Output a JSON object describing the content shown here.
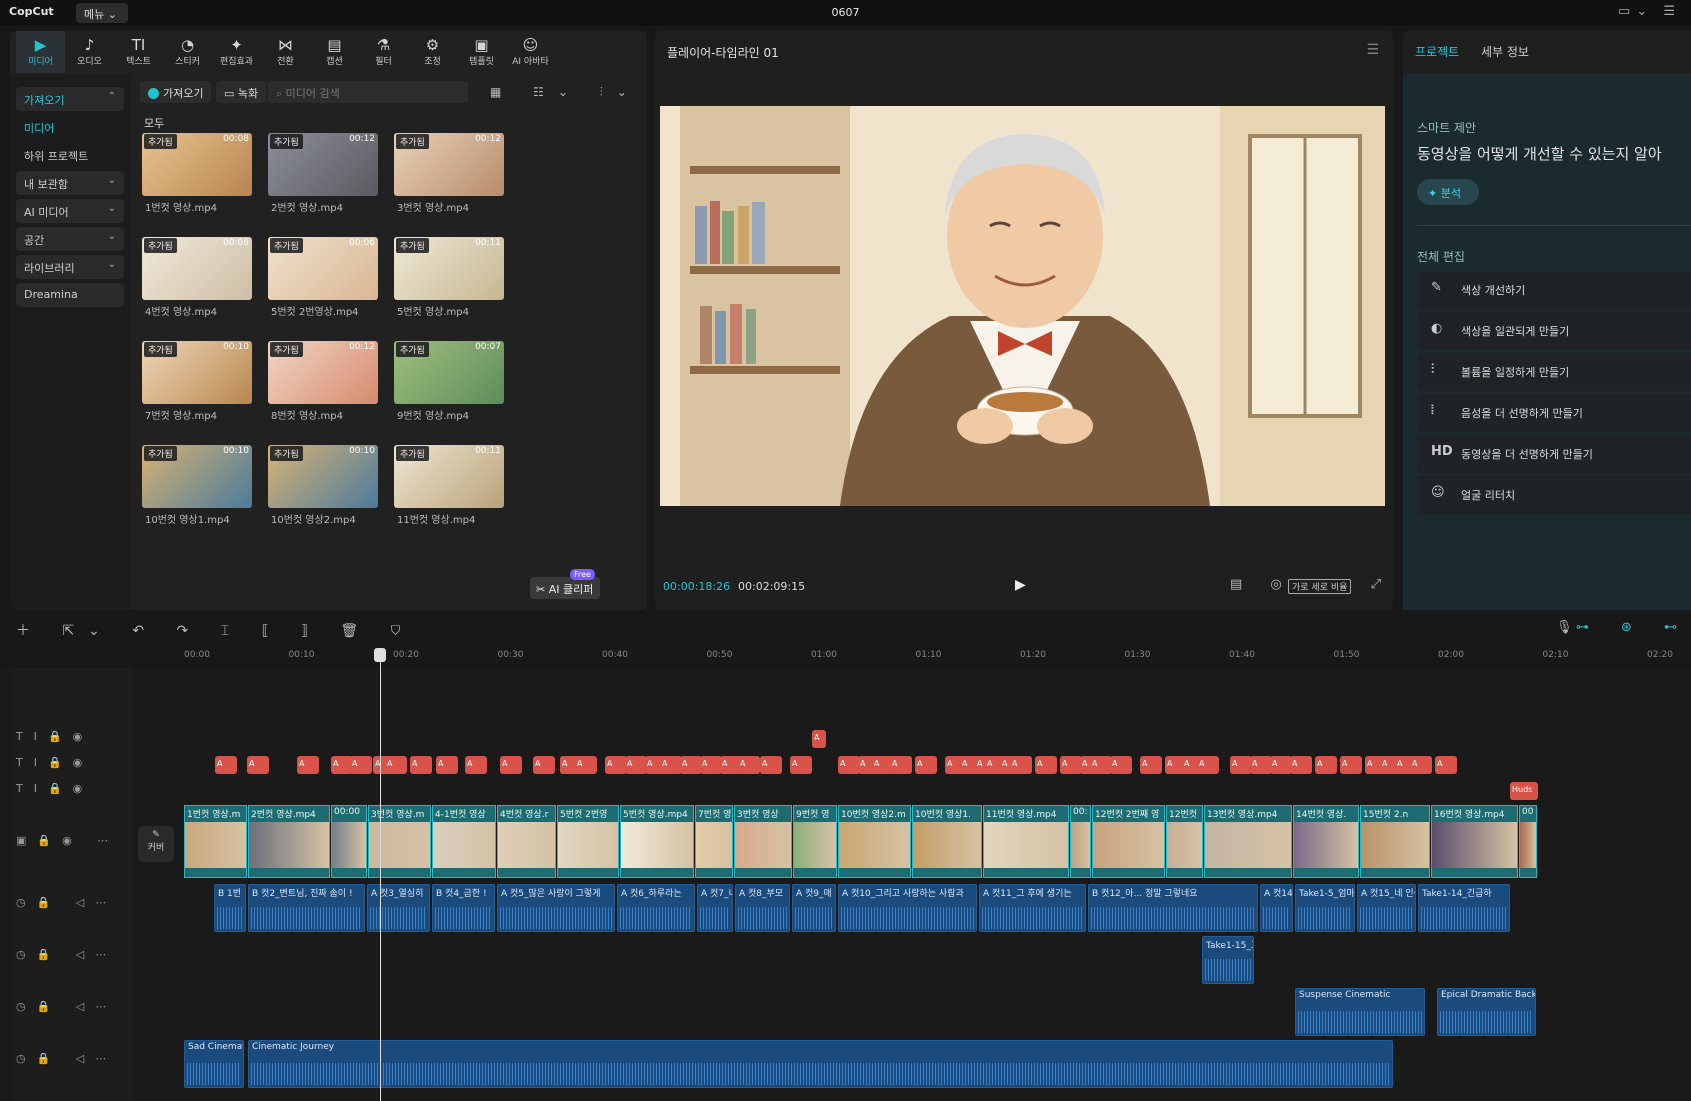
{
  "app": {
    "logo": "CopCut",
    "menu": "메뉴 ⌄",
    "project": "0607"
  },
  "toptools": [
    {
      "label": "미디어",
      "icon": "▶"
    },
    {
      "label": "오디오",
      "icon": "♪"
    },
    {
      "label": "텍스트",
      "icon": "TI"
    },
    {
      "label": "스티커",
      "icon": "◔"
    },
    {
      "label": "편집효과",
      "icon": "✦"
    },
    {
      "label": "전환",
      "icon": "⋈"
    },
    {
      "label": "캡션",
      "icon": "▤"
    },
    {
      "label": "필터",
      "icon": "⚗"
    },
    {
      "label": "조정",
      "icon": "⚙"
    },
    {
      "label": "템플릿",
      "icon": "▣"
    },
    {
      "label": "AI 아바타",
      "icon": "☺"
    }
  ],
  "leftnav": [
    {
      "label": "가져오기",
      "chev": "⌃"
    },
    {
      "label": "미디어",
      "chev": ""
    },
    {
      "label": "하위 프로젝트",
      "chev": ""
    },
    {
      "label": "내 보관함",
      "chev": "⌄"
    },
    {
      "label": "AI 미디어",
      "chev": "⌄"
    },
    {
      "label": "공간",
      "chev": "⌄"
    },
    {
      "label": "라이브러리",
      "chev": "⌄"
    },
    {
      "label": "Dreamina",
      "chev": ""
    }
  ],
  "media": {
    "import": "가져오기",
    "record": "녹화",
    "search_placeholder": "미디어 검색",
    "all": "모두",
    "tag": "추가됨",
    "aiclip": "AI 클리퍼",
    "free": "Free",
    "items": [
      {
        "name": "1번컷 영상.mp4",
        "dur": "00:08"
      },
      {
        "name": "2번컷 영상.mp4",
        "dur": "00:12"
      },
      {
        "name": "3번컷 영상.mp4",
        "dur": "00:12"
      },
      {
        "name": "4번컷 영상.mp4",
        "dur": "00:06"
      },
      {
        "name": "5번컷 2번영상.mp4",
        "dur": "00:06"
      },
      {
        "name": "5번컷 영상.mp4",
        "dur": "00:11"
      },
      {
        "name": "7번컷 영상.mp4",
        "dur": "00:10"
      },
      {
        "name": "8번컷 영상.mp4",
        "dur": "00:12"
      },
      {
        "name": "9번컷 영상.mp4",
        "dur": "00:07"
      },
      {
        "name": "10번컷 영상1.mp4",
        "dur": "00:10"
      },
      {
        "name": "10번컷 영상2.mp4",
        "dur": "00:10"
      },
      {
        "name": "11번컷 영상.mp4",
        "dur": "00:11"
      }
    ]
  },
  "player": {
    "title": "플레이어-타임라인 01",
    "current": "00:00:18:26",
    "total": "00:02:09:15",
    "ratio": "가로 세로 비율"
  },
  "right": {
    "tab_project": "프로젝트",
    "tab_detail": "세부 정보",
    "smart_title": "스마트 제안",
    "smart_question": "동영상을 어떻게 개선할 수 있는지 알아",
    "analyze": "분석",
    "all_edit": "전체 편집",
    "items": [
      {
        "label": "색상 개선하기",
        "icon": "✎"
      },
      {
        "label": "색상을 일관되게 만들기",
        "icon": "◐"
      },
      {
        "label": "볼륨을 일정하게 만들기",
        "icon": "⫶"
      },
      {
        "label": "음성을 더 선명하게 만들기",
        "icon": "⦙"
      },
      {
        "label": "동영상을 더 선명하게 만들기",
        "icon": "HD"
      },
      {
        "label": "얼굴 리터치",
        "icon": "☺"
      }
    ]
  },
  "timeline": {
    "ticks": [
      "00:00",
      "00:10",
      "00:20",
      "00:30",
      "00:40",
      "00:50",
      "01:00",
      "01:10",
      "01:20",
      "01:30",
      "01:40",
      "01:50",
      "02:00",
      "02:10",
      "02:20"
    ],
    "cover": "커버",
    "video_clips": [
      "1번컷 영상.m",
      "2번컷 영상.mp4",
      "00:00",
      "3번컷 영상.m",
      "4-1번컷 영상",
      "4번컷 영상.r",
      "5번컷 2번영",
      "5번컷 영상.mp4",
      "7번컷 영",
      "3번컷 영상",
      "9번컷 영",
      "10번컷 영상2.m",
      "10번컷 영상1.",
      "11번컷 영상.mp4",
      "00:",
      "12번컷 2번째 영",
      "12번컷",
      "13번컷 영상.mp4",
      "14번컷 영상.",
      "15번컷 2.n",
      "16번컷 영상.mp4",
      "00"
    ],
    "voice_clips": [
      "B 1번",
      "B 컷2_변트님, 진짜 솜이 !",
      "A 컷3_열심히",
      "B 컷4_금한 !",
      "A 컷5_많은 사랑이 그렇게",
      "A 컷6_하루라는",
      "A 컷7_니",
      "A 컷8_부모",
      "A 컷9_매",
      "A 컷10_그리고 사랑하는 사람과",
      "A 컷11_그 후에 생기는",
      "B 컷12_아... 정말 그렇네요",
      "A 컷14",
      "Take1-5_엄마",
      "A 컷15_네 인생",
      "Take1-14_긴급하"
    ],
    "take_clip": "Take1-15_그",
    "music_clips": [
      "Suspense Cinematic",
      "Epical Dramatic Back"
    ],
    "bg_clips": [
      "Sad Cinemat",
      "Cinematic Journey"
    ],
    "hud": "Huds",
    "chip": "A"
  }
}
